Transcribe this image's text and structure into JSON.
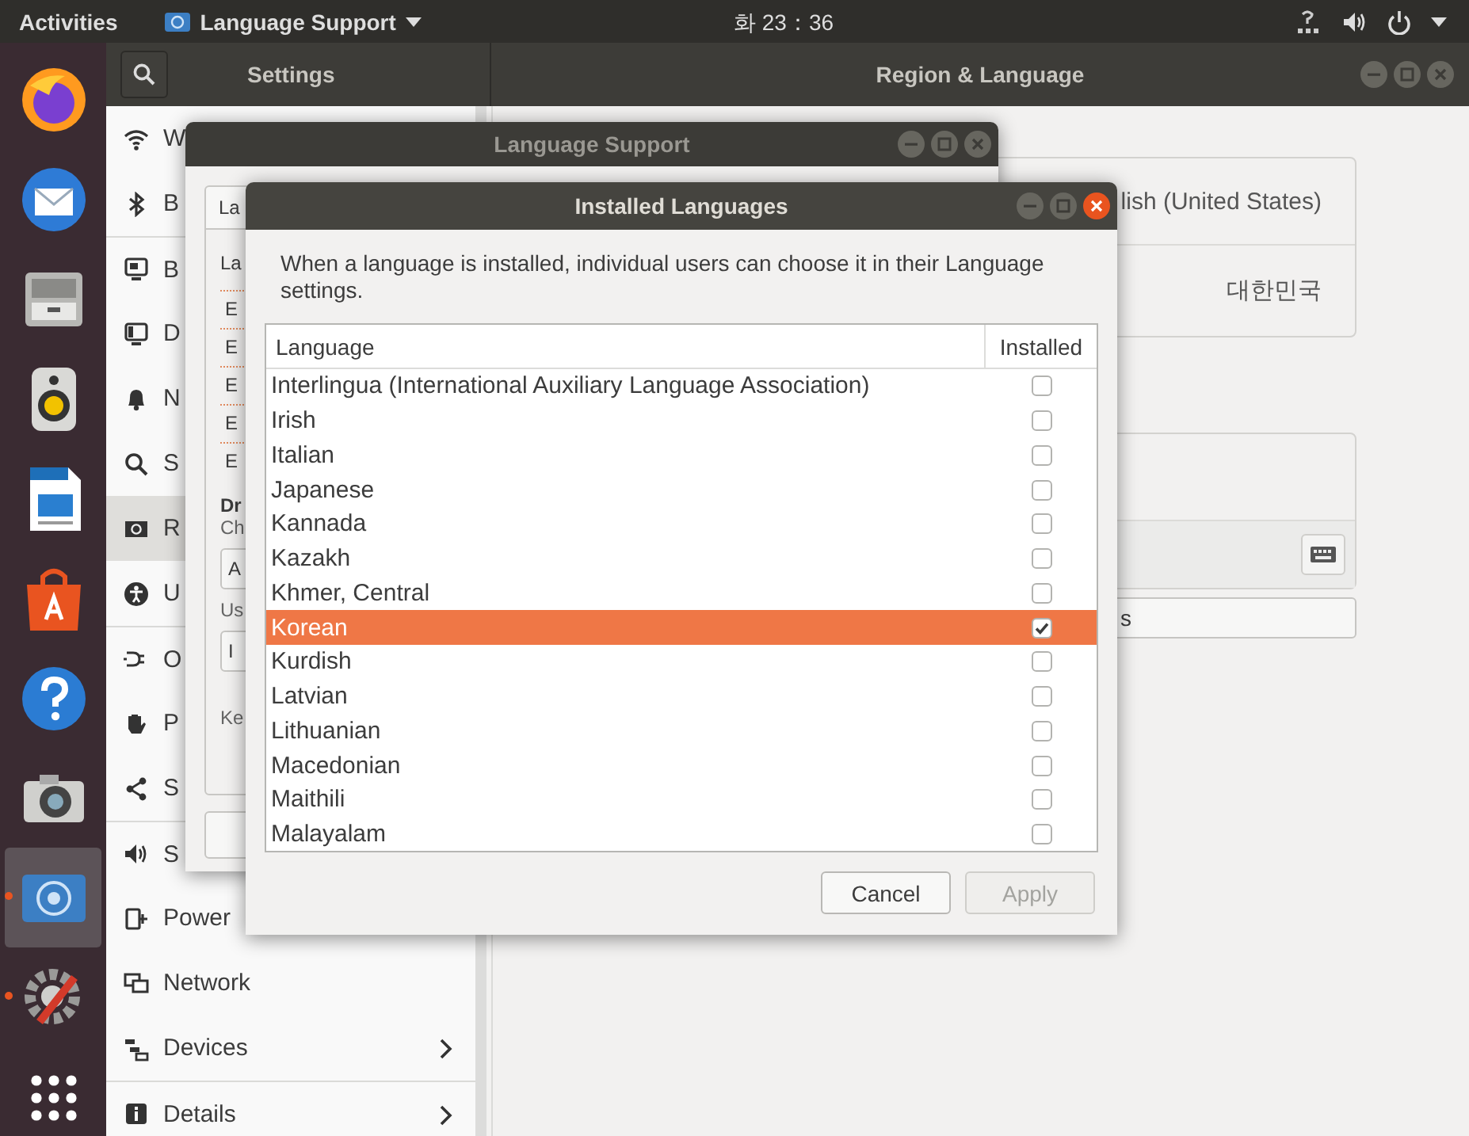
{
  "top_bar": {
    "activities": "Activities",
    "app_menu": "Language Support",
    "clock": "화 23：36"
  },
  "dock": {
    "items": [
      {
        "running": false,
        "selected": false
      },
      {
        "running": false,
        "selected": false
      },
      {
        "running": false,
        "selected": false
      },
      {
        "running": false,
        "selected": false
      },
      {
        "running": false,
        "selected": false
      },
      {
        "running": false,
        "selected": false
      },
      {
        "running": false,
        "selected": false
      },
      {
        "running": false,
        "selected": false
      },
      {
        "running": true,
        "selected": true
      },
      {
        "running": true,
        "selected": false
      }
    ]
  },
  "settings_window": {
    "focused": false,
    "sidebar_title": "Settings",
    "title": "Region & Language",
    "sidebar": [
      {
        "label": "W",
        "selected": false,
        "submenu": false
      },
      {
        "label": "B",
        "selected": false,
        "submenu": false
      },
      {
        "label": "B",
        "selected": false,
        "submenu": false
      },
      {
        "label": "D",
        "selected": false,
        "submenu": false
      },
      {
        "label": "N",
        "selected": false,
        "submenu": false
      },
      {
        "label": "S",
        "selected": false,
        "submenu": false
      },
      {
        "label": "R",
        "selected": true,
        "submenu": false
      },
      {
        "label": "U",
        "selected": false,
        "submenu": false
      },
      {
        "label": "O",
        "selected": false,
        "submenu": false
      },
      {
        "label": "P",
        "selected": false,
        "submenu": false
      },
      {
        "label": "S",
        "selected": false,
        "submenu": false
      },
      {
        "label": "S",
        "selected": false,
        "submenu": false
      },
      {
        "label": "Power",
        "selected": false,
        "submenu": false
      },
      {
        "label": "Network",
        "selected": false,
        "submenu": false
      },
      {
        "label": "Devices",
        "selected": false,
        "submenu": true
      },
      {
        "label": "Details",
        "selected": false,
        "submenu": true
      }
    ],
    "panel": {
      "language": "lish (United States)",
      "formats": "대한민국",
      "manage_button": "s"
    }
  },
  "language_support_window": {
    "focused": false,
    "title": "Language Support",
    "tab": "La",
    "heading": "La",
    "languages": [
      "E",
      "E",
      "E",
      "E",
      "E"
    ],
    "drag_title": "Dr",
    "drag_hint": "Ch",
    "first_button": "A",
    "use_label": "Us",
    "second_button": "I",
    "keyboard_label": "Ke"
  },
  "installed_languages_dialog": {
    "focused": true,
    "title": "Installed Languages",
    "message": "When a language is installed, individual users can choose it in their Language settings.",
    "columns": [
      "Language",
      "Installed"
    ],
    "rows": [
      {
        "name": "Interlingua (International Auxiliary Language Association)",
        "installed": false,
        "selected": false
      },
      {
        "name": "Irish",
        "installed": false,
        "selected": false
      },
      {
        "name": "Italian",
        "installed": false,
        "selected": false
      },
      {
        "name": "Japanese",
        "installed": false,
        "selected": false
      },
      {
        "name": "Kannada",
        "installed": false,
        "selected": false
      },
      {
        "name": "Kazakh",
        "installed": false,
        "selected": false
      },
      {
        "name": "Khmer, Central",
        "installed": false,
        "selected": false
      },
      {
        "name": "Korean",
        "installed": true,
        "selected": true
      },
      {
        "name": "Kurdish",
        "installed": false,
        "selected": false
      },
      {
        "name": "Latvian",
        "installed": false,
        "selected": false
      },
      {
        "name": "Lithuanian",
        "installed": false,
        "selected": false
      },
      {
        "name": "Macedonian",
        "installed": false,
        "selected": false
      },
      {
        "name": "Maithili",
        "installed": false,
        "selected": false
      },
      {
        "name": "Malayalam",
        "installed": false,
        "selected": false
      }
    ],
    "buttons": [
      {
        "label": "Cancel",
        "disabled": false
      },
      {
        "label": "Apply",
        "disabled": true
      }
    ]
  }
}
